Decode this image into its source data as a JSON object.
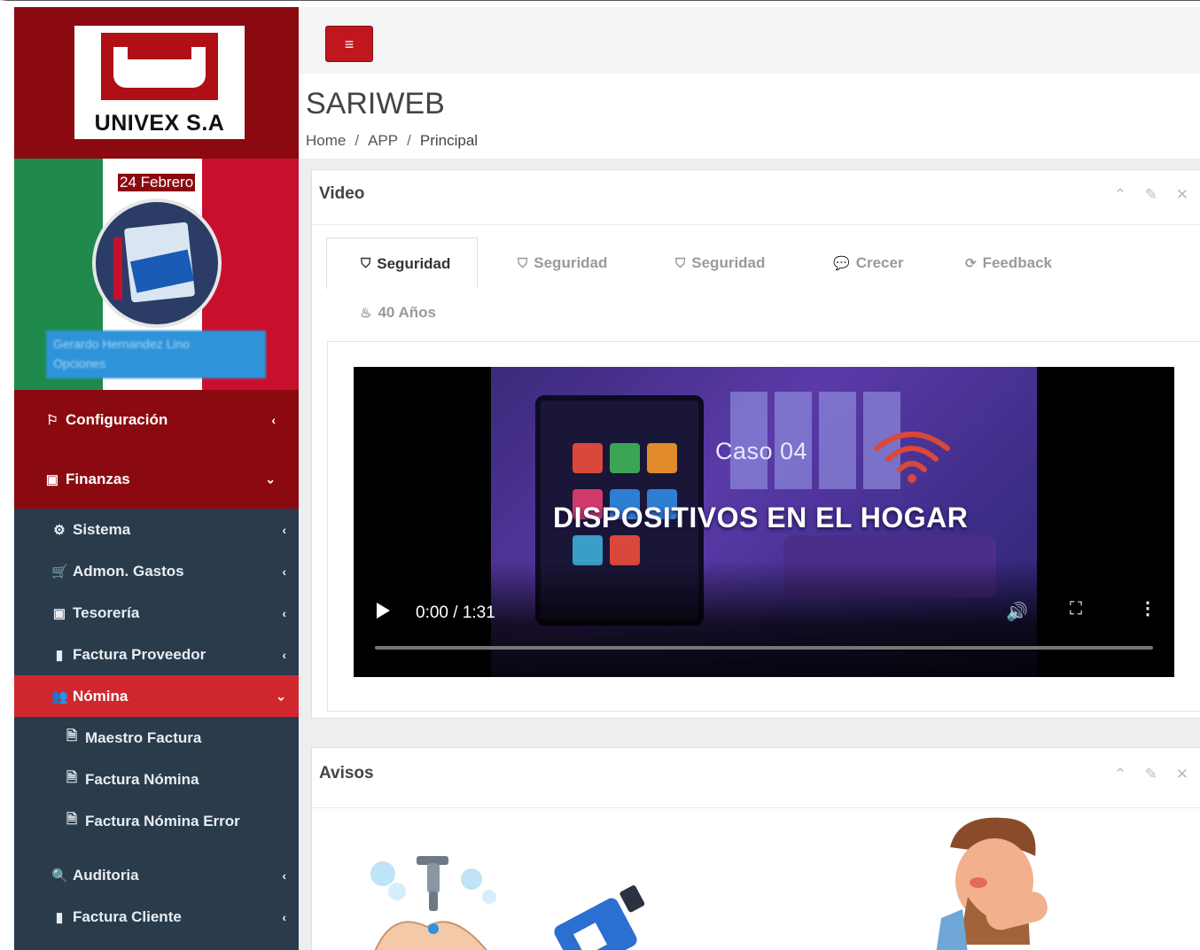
{
  "brand": {
    "logo_text": "UNIVEX S.A",
    "date_label": "24 Febrero",
    "user_name_blurred": "Gerardo Hernandez Lino",
    "user_options_blurred": "Opciones"
  },
  "sidebar": {
    "top_items": [
      {
        "label": "Configuración",
        "icon": "flag-icon",
        "chevron": "‹"
      },
      {
        "label": "Finanzas",
        "icon": "money-icon",
        "chevron": "⌄"
      }
    ],
    "sub_items": [
      {
        "label": "Sistema",
        "icon": "cogs-icon",
        "chevron": "‹"
      },
      {
        "label": "Admon. Gastos",
        "icon": "cart-icon",
        "chevron": "‹"
      },
      {
        "label": "Tesorería",
        "icon": "money-icon",
        "chevron": "‹"
      },
      {
        "label": "Factura Proveedor",
        "icon": "file-icon",
        "chevron": "‹"
      },
      {
        "label": "Nómina",
        "icon": "users-icon",
        "chevron": "⌄"
      },
      {
        "label": "Maestro Factura",
        "icon": "file-text-icon"
      },
      {
        "label": "Factura Nómina",
        "icon": "file-text-icon"
      },
      {
        "label": "Factura Nómina Error",
        "icon": "file-text-icon"
      },
      {
        "label": "Auditoria",
        "icon": "search-plus-icon",
        "chevron": "‹"
      },
      {
        "label": "Factura Cliente",
        "icon": "file-icon",
        "chevron": "‹"
      }
    ]
  },
  "header": {
    "menu_toggle_glyph": "≡",
    "title": "SARIWEB",
    "breadcrumb": [
      "Home",
      "APP",
      "Principal"
    ],
    "breadcrumb_sep": "/"
  },
  "video_panel": {
    "title": "Video",
    "tools": "⌃ ✎ ✕",
    "tabs": [
      {
        "label": "Seguridad",
        "icon": "shield-icon",
        "active": true
      },
      {
        "label": "Seguridad",
        "icon": "shield-icon",
        "active": false
      },
      {
        "label": "Seguridad",
        "icon": "shield-icon",
        "active": false
      },
      {
        "label": "Crecer",
        "icon": "comment-icon",
        "active": false
      },
      {
        "label": "Feedback",
        "icon": "refresh-icon",
        "active": false
      },
      {
        "label": "40 Años",
        "icon": "cake-icon",
        "active": false
      }
    ],
    "video": {
      "case_text": "Caso 04",
      "headline": "DISPOSITIVOS EN EL HOGAR",
      "time": "0:00 / 1:31",
      "progress": 0
    }
  },
  "avisos_panel": {
    "title": "Avisos",
    "tools": "⌃ ✎ ✕"
  },
  "colors": {
    "brand_red": "#8b0a10",
    "active_red": "#d0272f",
    "sidebar_dark": "#2a3b4c"
  }
}
